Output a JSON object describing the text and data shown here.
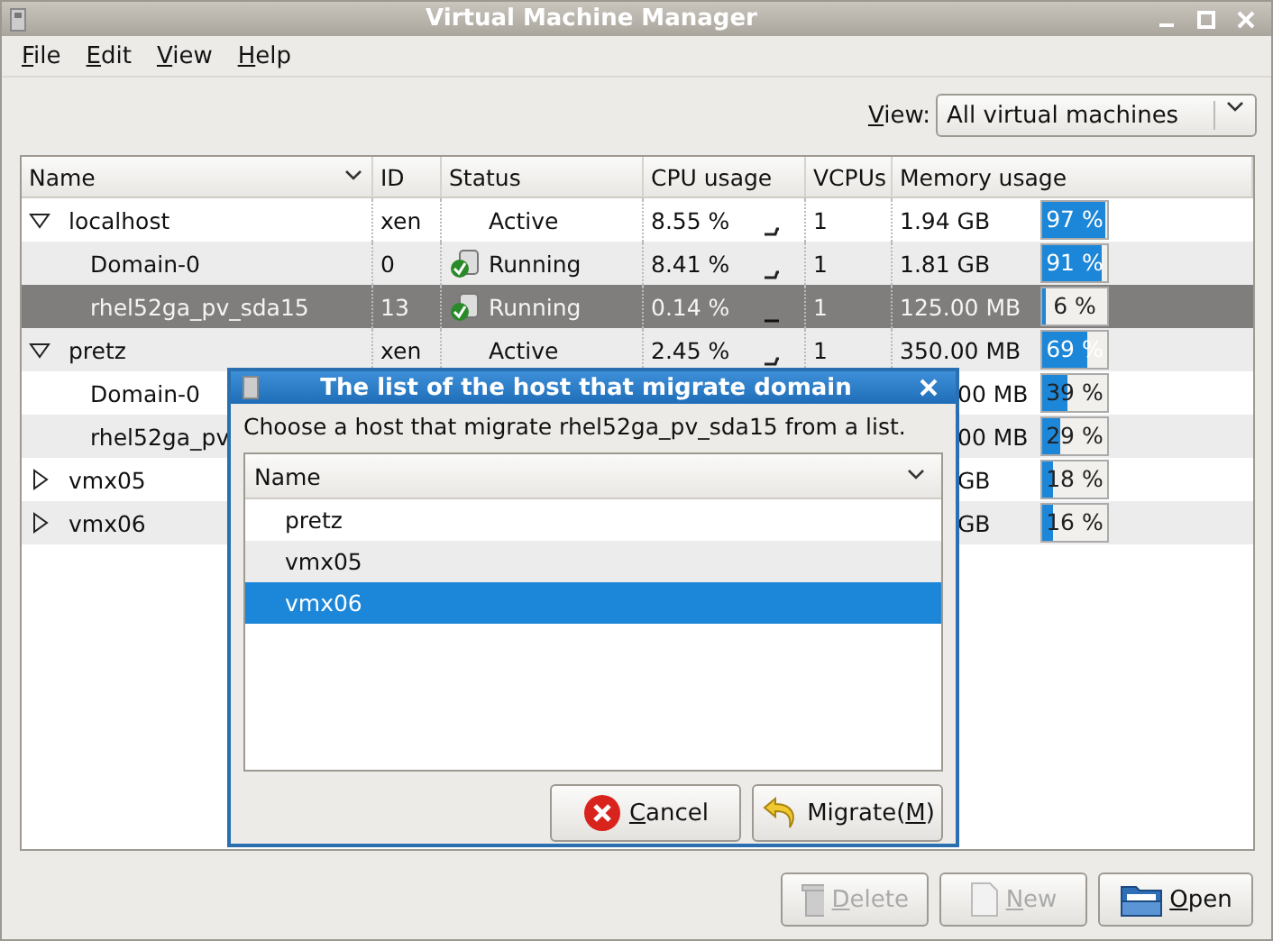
{
  "window": {
    "title": "Virtual Machine Manager"
  },
  "menu": [
    {
      "mnemonic": "F",
      "rest": "ile"
    },
    {
      "mnemonic": "E",
      "rest": "dit"
    },
    {
      "mnemonic": "V",
      "rest": "iew"
    },
    {
      "mnemonic": "H",
      "rest": "elp"
    }
  ],
  "view_filter": {
    "label_mnemonic": "V",
    "label_rest": "iew:",
    "value": "All virtual machines"
  },
  "table": {
    "columns": [
      "Name",
      "ID",
      "Status",
      "CPU usage",
      "VCPUs",
      "Memory usage"
    ],
    "rows": [
      {
        "kind": "host",
        "name": "localhost",
        "expanded": true,
        "id": "xen",
        "status": "Active",
        "cpu": "8.55 %",
        "vcpus": "1",
        "memory": "1.94 GB",
        "level": 0.97,
        "reading": "97 %",
        "selected": false,
        "children": [
          {
            "kind": "vm",
            "name": "Domain-0",
            "id": "0",
            "status": "Running",
            "cpu": "8.41 %",
            "vcpus": "1",
            "memory": "1.81 GB",
            "level": 0.91,
            "reading": "91 %",
            "selected": false
          },
          {
            "kind": "vm",
            "name": "rhel52ga_pv_sda15",
            "id": "13",
            "status": "Running",
            "cpu": "0.14 %",
            "vcpus": "1",
            "memory": "125.00 MB",
            "level": 0.06,
            "reading": "6 %",
            "selected": true
          }
        ]
      },
      {
        "kind": "host",
        "name": "pretz",
        "expanded": true,
        "id": "xen",
        "status": "Active",
        "cpu": "2.45 %",
        "vcpus": "1",
        "memory": "350.00 MB",
        "level": 0.69,
        "reading": "69 %",
        "selected": false,
        "children": [
          {
            "kind": "vm",
            "name": "Domain-0",
            "memory": "00 MB",
            "clipped": true,
            "level": 0.39,
            "reading": "39 %",
            "selected": false
          },
          {
            "kind": "vm",
            "name": "rhel52ga_pv",
            "memory": "00 MB",
            "clipped": true,
            "level": 0.29,
            "reading": "29 %",
            "selected": false
          }
        ]
      },
      {
        "kind": "host",
        "name": "vmx05",
        "expanded": false,
        "memory": "GB",
        "clipped": true,
        "level": 0.18,
        "reading": "18 %",
        "selected": false
      },
      {
        "kind": "host",
        "name": "vmx06",
        "expanded": false,
        "memory": "GB",
        "clipped": true,
        "level": 0.16,
        "reading": "16 %",
        "selected": false
      }
    ]
  },
  "buttons": [
    {
      "mnemonic": "D",
      "rest": "elete",
      "kind": "delete",
      "disabled": true
    },
    {
      "mnemonic": "N",
      "rest": "ew",
      "kind": "new",
      "disabled": true
    },
    {
      "mnemonic": "O",
      "rest": "pen",
      "kind": "open",
      "disabled": false
    }
  ],
  "dialog": {
    "title": "The list of the host that migrate domain",
    "message": "Choose a host that migrate rhel52ga_pv_sda15 from a list.",
    "column": "Name",
    "hosts": [
      {
        "name": "pretz",
        "selected": false
      },
      {
        "name": "vmx05",
        "selected": false
      },
      {
        "name": "vmx06",
        "selected": true
      }
    ],
    "cancel": {
      "mnemonic": "C",
      "rest": "ancel"
    },
    "migrate": {
      "before": "Migrate(",
      "mnemonic": "M",
      "after": ")"
    }
  }
}
